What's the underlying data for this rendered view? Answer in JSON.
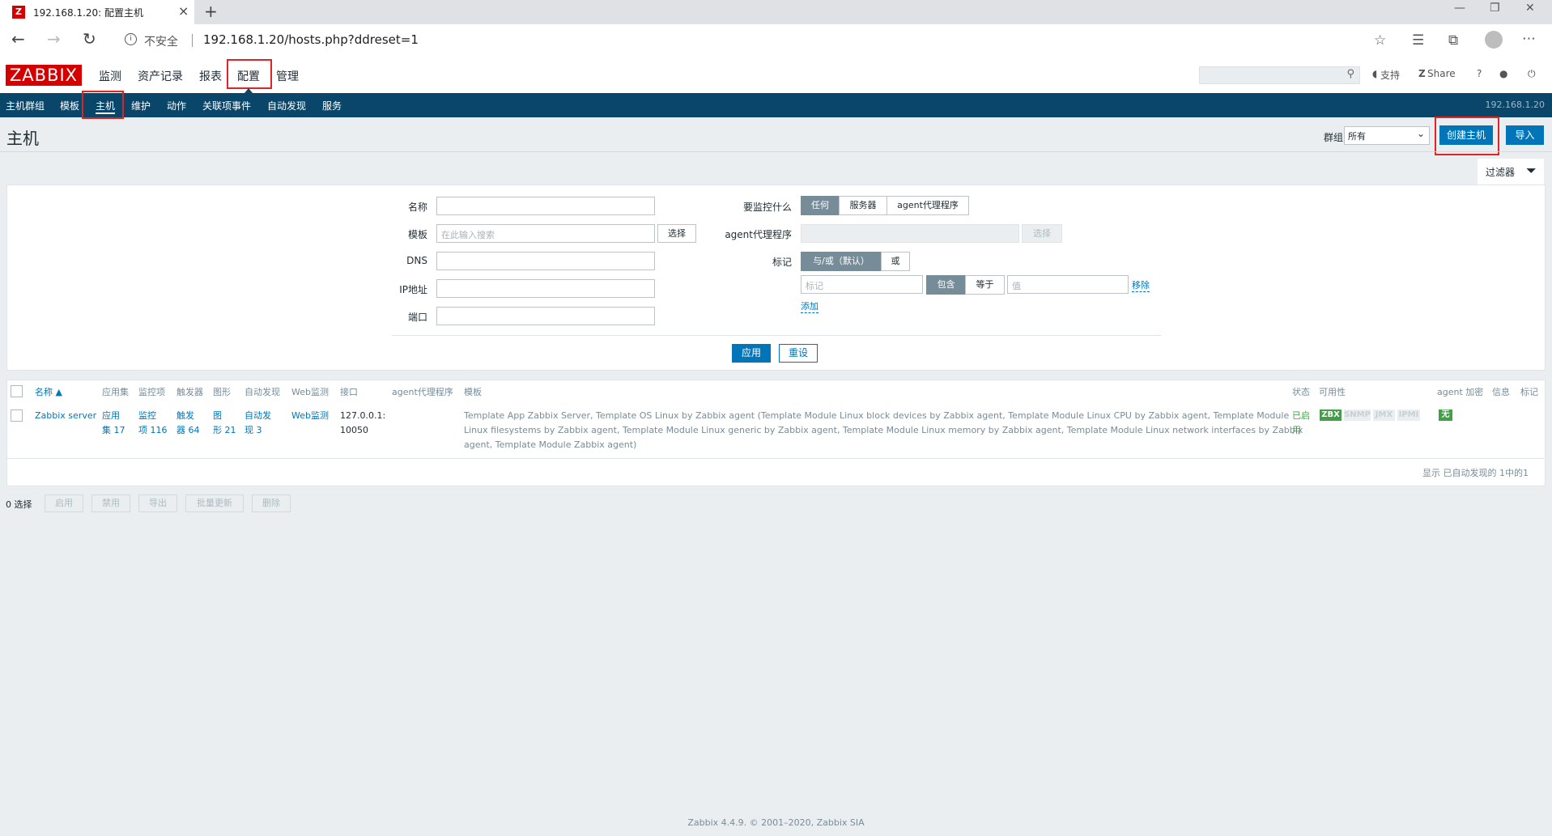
{
  "browser": {
    "tab_title": "192.168.1.20: 配置主机",
    "favicon_letter": "Z",
    "security": "不安全",
    "url": "192.168.1.20/hosts.php?ddreset=1"
  },
  "header": {
    "logo": "ZABBIX",
    "menu": [
      "监测",
      "资产记录",
      "报表",
      "配置",
      "管理"
    ],
    "support": "支持",
    "share": "Share",
    "help": "?"
  },
  "subnav": {
    "items": [
      "主机群组",
      "模板",
      "主机",
      "维护",
      "动作",
      "关联项事件",
      "自动发现",
      "服务"
    ],
    "host": "192.168.1.20"
  },
  "page": {
    "title": "主机",
    "group_label": "群组",
    "group_value": "所有",
    "create_button": "创建主机",
    "import_button": "导入"
  },
  "filter": {
    "tab_label": "过滤器",
    "name_label": "名称",
    "template_label": "模板",
    "template_placeholder": "在此输入搜索",
    "select_button": "选择",
    "dns_label": "DNS",
    "ip_label": "IP地址",
    "port_label": "端口",
    "monitored_by_label": "要监控什么",
    "monitored_by_options": [
      "任何",
      "服务器",
      "agent代理程序"
    ],
    "proxy_label": "agent代理程序",
    "proxy_select": "选择",
    "tags_label": "标记",
    "tags_mode": [
      "与/或（默认）",
      "或"
    ],
    "tag_placeholder": "标记",
    "tag_ops": [
      "包含",
      "等于"
    ],
    "value_placeholder": "值",
    "remove_link": "移除",
    "add_link": "添加",
    "apply_button": "应用",
    "reset_button": "重设"
  },
  "table": {
    "headers": {
      "name": "名称 ▲",
      "applications": "应用集",
      "items": "监控项",
      "triggers": "触发器",
      "graphs": "图形",
      "discovery": "自动发现",
      "web": "Web监测",
      "interface": "接口",
      "proxy": "agent代理程序",
      "templates": "模板",
      "status": "状态",
      "availability": "可用性",
      "encryption": "agent 加密",
      "info": "信息",
      "tags": "标记"
    },
    "row": {
      "name": "Zabbix server",
      "applications_1": "应用",
      "applications_2": "集 17",
      "items_1": "监控",
      "items_2": "项 116",
      "triggers_1": "触发",
      "triggers_2": "器 64",
      "graphs_1": "图",
      "graphs_2": "形 21",
      "discovery_1": "自动发",
      "discovery_2": "现 3",
      "web": "Web监测",
      "interface_1": "127.0.0.1:",
      "interface_2": "10050",
      "templates_line1": "Template App Zabbix Server, Template OS Linux by Zabbix agent (Template Module Linux block devices by Zabbix agent, Template Module Linux CPU by Zabbix agent, Template Module",
      "templates_line2": "Linux filesystems by Zabbix agent, Template Module Linux generic by Zabbix agent, Template Module Linux memory by Zabbix agent, Template Module Linux network interfaces by Zabbix",
      "templates_line3": "agent, Template Module Zabbix agent)",
      "status_1": "已启",
      "status_2": "用",
      "availability": [
        "ZBX",
        "SNMP",
        "JMX",
        "IPMI"
      ],
      "encryption": "无"
    },
    "summary": "显示 已自动发现的 1中的1"
  },
  "actions": {
    "selected": "0 选择",
    "buttons": [
      "启用",
      "禁用",
      "导出",
      "批量更新",
      "删除"
    ]
  },
  "footer": "Zabbix 4.4.9. © 2001–2020, Zabbix SIA",
  "colors": {
    "brand_red": "#d40000",
    "nav_blue": "#0a466a",
    "accent_blue": "#0275b8",
    "status_green": "#429e47",
    "highlight_red": "#e02424"
  }
}
